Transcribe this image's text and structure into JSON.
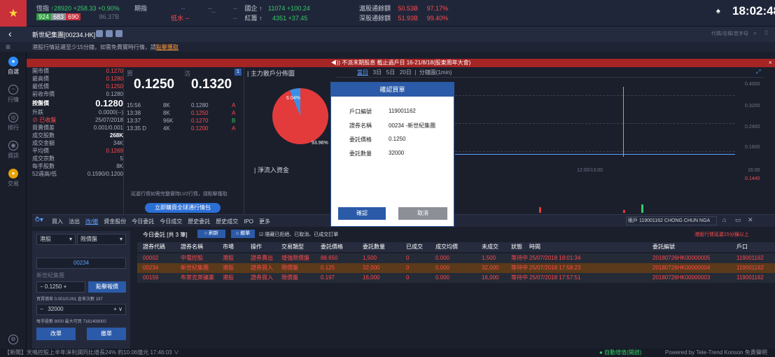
{
  "topbar": {
    "hsi_label": "恆指",
    "hsi_value": "↑28920",
    "hsi_change": "+258.33",
    "hsi_pct": "+0.90%",
    "hsi_up": "924",
    "hsi_flat": "683",
    "hsi_down": "690",
    "hsi_turnover": "86.37B",
    "fut_label": "期指",
    "fut_value": "--",
    "fut_change": "--",
    "fut_sub": "低水 --",
    "g1_label": "--",
    "g1_b": "--",
    "gold_label": "國企 ↑",
    "gold_value": "11074",
    "gold_change": "+100.24",
    "red_label": "紅籌 ↑",
    "red_value": "4351",
    "red_change": "+37.45",
    "sh_label": "滬股通餘額",
    "sh_value": "50.53B",
    "sh_pct": "97.17%",
    "sz_label": "深股通餘額",
    "sz_value": "51.93B",
    "sz_pct": "99.40%",
    "clock": "18:02:48"
  },
  "sub": {
    "title": "新世紀集團[00234.HK]",
    "search_placeholder": "代碼/名稱/首字母"
  },
  "notice": {
    "text": "港股行情延遲至少15分鐘，如需免費實時行情，請",
    "link": "點擊獲取"
  },
  "banner": "◀)) 不派末期股息 截止過戶日 16-21/8/18(股東周年大會)",
  "nav": [
    {
      "label": "自選",
      "icon": "star-icon"
    },
    {
      "label": "行情",
      "icon": "chart-icon"
    },
    {
      "label": "排行",
      "icon": "rank-icon"
    },
    {
      "label": "資訊",
      "icon": "news-icon"
    },
    {
      "label": "交易",
      "icon": "trade-icon"
    }
  ],
  "quote": [
    {
      "l": "開市價",
      "v": "0.1270",
      "c": "red"
    },
    {
      "l": "最高價",
      "v": "0.1280",
      "c": "red"
    },
    {
      "l": "最低價",
      "v": "0.1250",
      "c": "red"
    },
    {
      "l": "前收市價",
      "v": "0.1280",
      "c": "dim"
    },
    {
      "l": "按盤價",
      "v": "0.1280",
      "c": "big"
    },
    {
      "l": "升跌",
      "v": "0.0000(--)",
      "c": "dim"
    },
    {
      "l": "⊘ 已收盤",
      "v": "25/07/2018",
      "c": "dim"
    },
    {
      "l": "買賣價差",
      "v": "0.001/0.001",
      "c": "dim"
    },
    {
      "l": "成交股數",
      "v": "268K",
      "c": "bold"
    },
    {
      "l": "成交金額",
      "v": "34K",
      "c": "dim"
    },
    {
      "l": "平均價",
      "v": "0.1269",
      "c": "red"
    },
    {
      "l": "成交宗數",
      "v": "5",
      "c": "dim"
    },
    {
      "l": "每手股數",
      "v": "8K",
      "c": "dim"
    },
    {
      "l": "52週高/低",
      "v": "0.1590/0.1200",
      "c": "dim"
    }
  ],
  "bidask": {
    "buy_label": "買",
    "sell_label": "沽",
    "buy": "0.1250",
    "sell": "0.1320",
    "page": "1",
    "ticks": [
      {
        "t": "15:56",
        "q": "8K",
        "p": "0.1280",
        "s": "A"
      },
      {
        "t": "13:38",
        "q": "8K",
        "p": "0.1250",
        "s": "A"
      },
      {
        "t": "13:37",
        "q": "96K",
        "p": "0.1270",
        "s": "B"
      },
      {
        "t": "13:35 D",
        "q": "4K",
        "p": "0.1200",
        "s": "A"
      }
    ],
    "lv2_note": "延遲行情如需完整實時LV2行情，請點擊獲取",
    "buy_btn": "立即購買全球通行情包"
  },
  "chartA": {
    "title": "主力散戶分佈圖",
    "pct1": "6.04%",
    "pct2": "93.96%",
    "flow_title": "淨流入資金"
  },
  "chartB": {
    "tabs": [
      "當日",
      "3日",
      "5日",
      "20日",
      "分鐘圖(1min)"
    ],
    "y_labels": [
      "0.4000",
      "0.3200",
      "0.2400",
      "0.1600",
      "0.1440"
    ],
    "time1": "12:00/13:00",
    "time2": "16:00"
  },
  "dialog": {
    "title": "確認買單",
    "rows": [
      {
        "l": "戶口編號",
        "v": "119001162"
      },
      {
        "l": "證券名稱",
        "v": "00234 -新世紀集團"
      },
      {
        "l": "委託價格",
        "v": "0.1250"
      },
      {
        "l": "委託數量",
        "v": "32000"
      }
    ],
    "ok": "確認",
    "cancel": "取消"
  },
  "tradebar": {
    "tabs": [
      "買入",
      "沽出",
      "改/撤",
      "資金股份",
      "今日委託",
      "今日成交",
      "歷史委託",
      "歷史成交",
      "IPO",
      "更多"
    ],
    "account": "賬戶 119001162 CHONG CHUN NGA"
  },
  "orderform": {
    "market": "港股",
    "type": "限價盤",
    "code": "00234",
    "name": "新世紀集團",
    "price": "0.1250",
    "tick_btn": "點擊報價",
    "spread": "買賣價差 0.001/0.001 倉差次數 197",
    "qty": "32000",
    "lot": "每手股數 8000 最大可買 7181408000",
    "modify": "改單",
    "cancel": "撤單"
  },
  "ordertable": {
    "title": "今日委託 [共 3 筆]",
    "refresh": "刷新",
    "cancel_btn": "撤單",
    "filter": "隱藏已拒絕、已取消、已成交訂單",
    "delay": "港股行情延遲15分鐘以上",
    "headers": [
      "證券代碼",
      "證券名稱",
      "市場",
      "操作",
      "交易類型",
      "委託價格",
      "委託數量",
      "已成交",
      "成交均價",
      "未成交",
      "狀態",
      "時間",
      "委託編號",
      "戶口"
    ],
    "rows": [
      [
        "00002",
        "中電控股",
        "港股",
        "證券賣出",
        "增強限價盤",
        "88.650",
        "1,500",
        "0",
        "0.000",
        "1,500",
        "等待中",
        "25/07/2018 18:01:34",
        "20180726HK00000005",
        "119001162"
      ],
      [
        "00234",
        "新世紀集團",
        "港股",
        "證券買入",
        "限價盤",
        "0.125",
        "32,000",
        "0",
        "0.000",
        "32,000",
        "等待中",
        "25/07/2018 17:58:23",
        "20180726HK00000004",
        "119001162"
      ],
      [
        "00159",
        "布萊克萊礦業",
        "港股",
        "證券買入",
        "限價盤",
        "0.197",
        "16,000",
        "0",
        "0.000",
        "16,000",
        "等待中",
        "25/07/2018 17:57:51",
        "20180726HK00000003",
        "119001162"
      ]
    ]
  },
  "footer": {
    "news": "【新聞】天鳴控股上半年淨利潤同比增長24% 約10.06億元  17:46:03 ∨",
    "status": "● 自動增值(開啟)",
    "powered": "Powered by Tele-Trend Konson  免責聲明"
  }
}
